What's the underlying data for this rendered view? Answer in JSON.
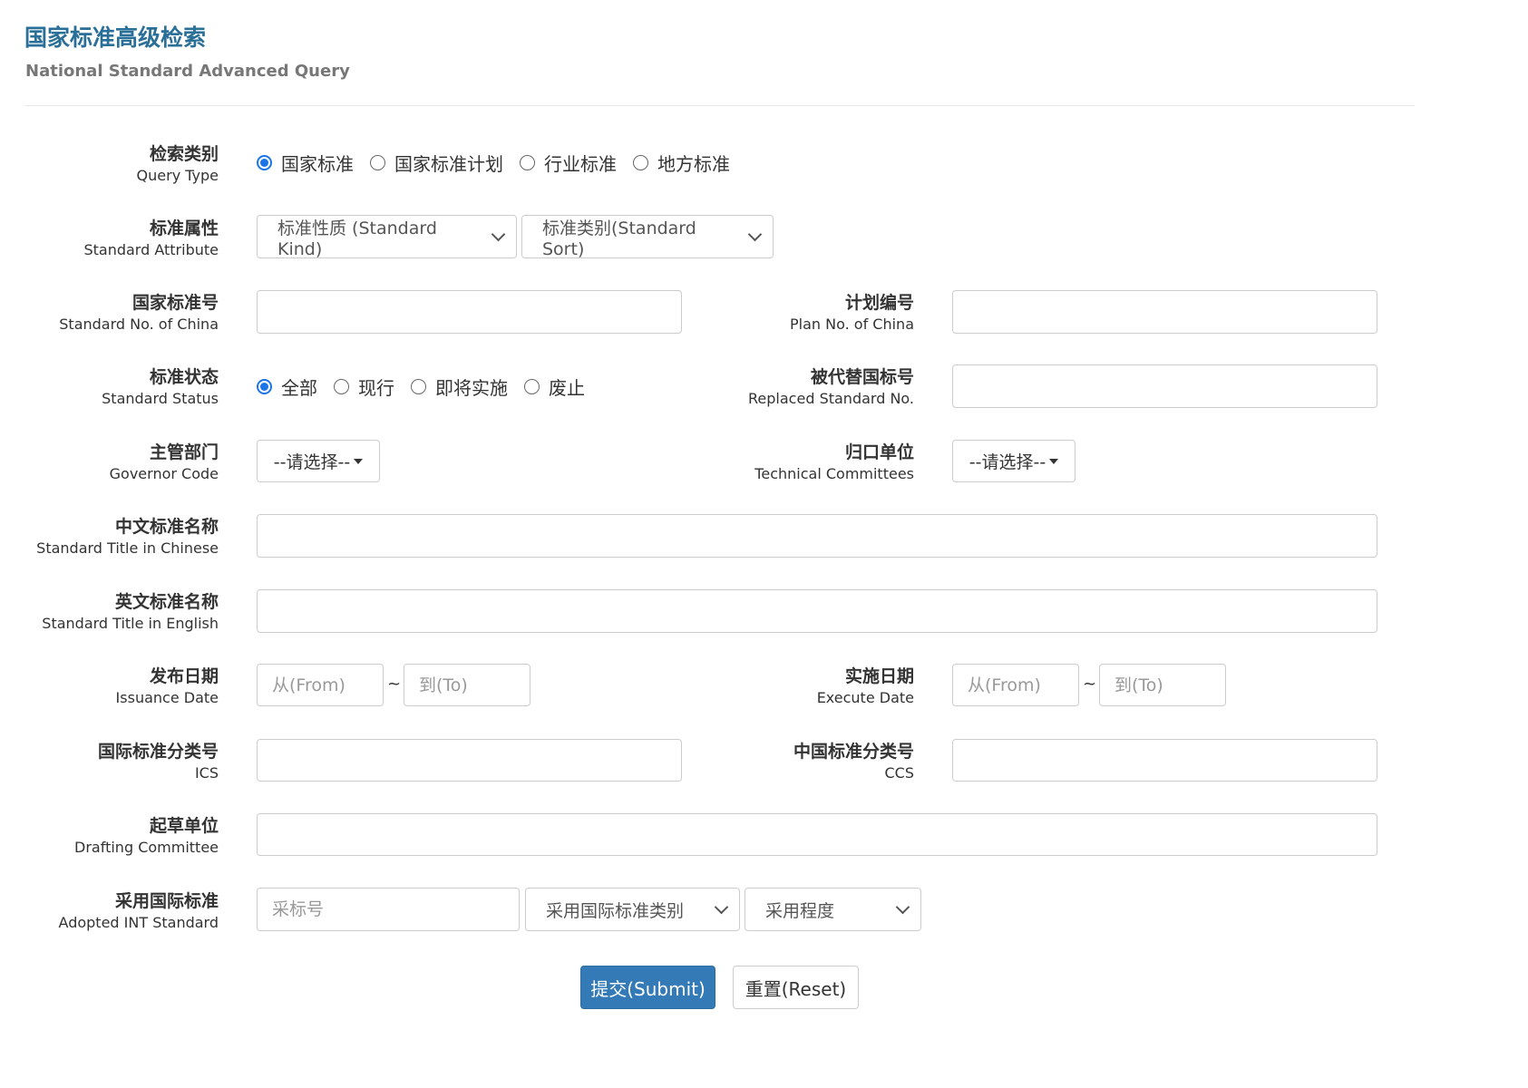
{
  "header": {
    "title": "国家标准高级检索",
    "subtitle": "National Standard Advanced Query"
  },
  "query_type": {
    "label_zh": "检索类别",
    "label_en": "Query Type",
    "options": [
      "国家标准",
      "国家标准计划",
      "行业标准",
      "地方标准"
    ],
    "selected": "国家标准"
  },
  "standard_attribute": {
    "label_zh": "标准属性",
    "label_en": "Standard Attribute",
    "kind_value": "标准性质 (Standard Kind)",
    "sort_value": "标准类别(Standard Sort)"
  },
  "standard_no": {
    "label_zh": "国家标准号",
    "label_en": "Standard No. of China",
    "value": ""
  },
  "plan_no": {
    "label_zh": "计划编号",
    "label_en": "Plan No. of China",
    "value": ""
  },
  "standard_status": {
    "label_zh": "标准状态",
    "label_en": "Standard Status",
    "options": [
      "全部",
      "现行",
      "即将实施",
      "废止"
    ],
    "selected": "全部"
  },
  "replaced_no": {
    "label_zh": "被代替国标号",
    "label_en": "Replaced Standard No.",
    "value": ""
  },
  "governor": {
    "label_zh": "主管部门",
    "label_en": "Governor Code",
    "value": "--请选择--"
  },
  "committees": {
    "label_zh": "归口单位",
    "label_en": "Technical Committees",
    "value": "--请选择--"
  },
  "title_cn": {
    "label_zh": "中文标准名称",
    "label_en": "Standard Title in Chinese",
    "value": ""
  },
  "title_en": {
    "label_zh": "英文标准名称",
    "label_en": "Standard Title in English",
    "value": ""
  },
  "issuance_date": {
    "label_zh": "发布日期",
    "label_en": "Issuance Date",
    "from_placeholder": "从(From)",
    "to_placeholder": "到(To)",
    "separator": "~"
  },
  "execute_date": {
    "label_zh": "实施日期",
    "label_en": "Execute Date",
    "from_placeholder": "从(From)",
    "to_placeholder": "到(To)",
    "separator": "~"
  },
  "ics": {
    "label_zh": "国际标准分类号",
    "label_en": "ICS",
    "value": ""
  },
  "ccs": {
    "label_zh": "中国标准分类号",
    "label_en": "CCS",
    "value": ""
  },
  "drafting": {
    "label_zh": "起草单位",
    "label_en": "Drafting Committee",
    "value": ""
  },
  "adopted": {
    "label_zh": "采用国际标准",
    "label_en": "Adopted INT Standard",
    "no_placeholder": "采标号",
    "type_value": "采用国际标准类别",
    "degree_value": "采用程度"
  },
  "actions": {
    "submit_label": "提交(Submit)",
    "reset_label": "重置(Reset)"
  },
  "colors": {
    "title": "#2a6f97",
    "primary_button": "#337ab7",
    "radio_checked": "#1b74e8"
  }
}
